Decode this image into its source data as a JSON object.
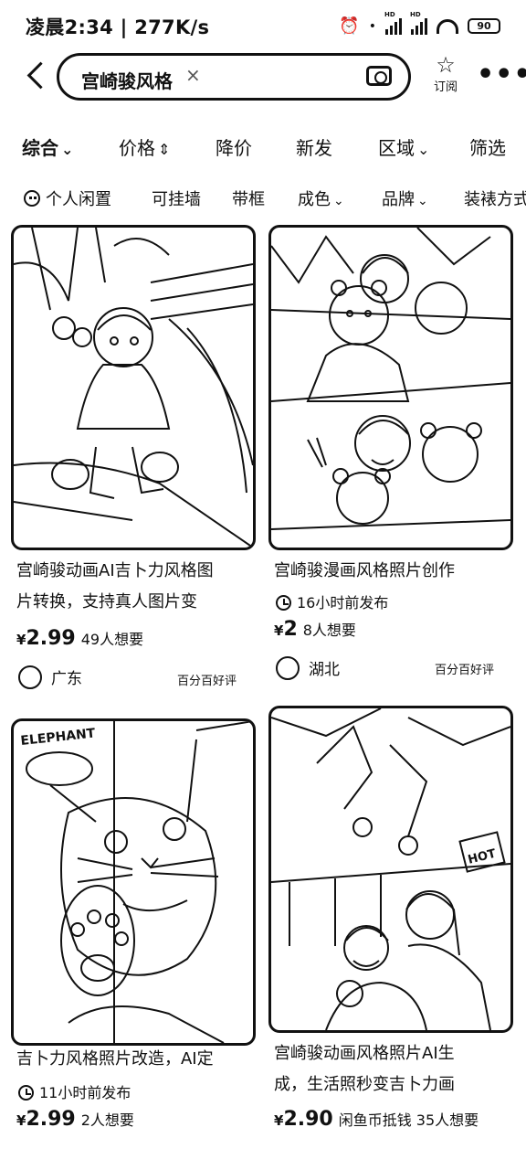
{
  "status_bar": {
    "time": "凌晨2:34 | 277K/s",
    "battery": "90"
  },
  "search": {
    "query": "宫崎骏风格",
    "clear": "×"
  },
  "header": {
    "subscribe_label": "订阅",
    "more": "•••"
  },
  "sort_tabs": [
    {
      "label": "综合",
      "arrow": "⌄"
    },
    {
      "label": "价格",
      "arrow": "⇕"
    },
    {
      "label": "降价",
      "arrow": ""
    },
    {
      "label": "新发",
      "arrow": ""
    },
    {
      "label": "区域",
      "arrow": "⌄"
    },
    {
      "label": "筛选",
      "arrow": ""
    }
  ],
  "chips": [
    {
      "label": "个人闲置",
      "arrow": ""
    },
    {
      "label": "可挂墙",
      "arrow": ""
    },
    {
      "label": "带框",
      "arrow": ""
    },
    {
      "label": "成色",
      "arrow": "⌄"
    },
    {
      "label": "品牌",
      "arrow": "⌄"
    },
    {
      "label": "装裱方式",
      "arrow": ""
    }
  ],
  "products": [
    {
      "title_line1": "宫崎骏动画AI吉卜力风格图",
      "title_line2": "片转换，支持真人图片变",
      "posted": "",
      "currency": "¥",
      "price": "2.99",
      "want": "49人想要",
      "region": "广东",
      "badge": "百分百好评"
    },
    {
      "title_line1": "宫崎骏漫画风格照片创作",
      "title_line2": "",
      "posted": "16小时前发布",
      "currency": "¥",
      "price": "2",
      "want": "8人想要",
      "region": "湖北",
      "badge": "百分百好评"
    },
    {
      "title_line1": "吉卜力风格照片改造，AI定",
      "title_line2": "",
      "posted": "11小时前发布",
      "currency": "¥",
      "price": "2.99",
      "want": "2人想要",
      "region": "",
      "badge": ""
    },
    {
      "title_line1": "宫崎骏动画风格照片AI生",
      "title_line2": "成，生活照秒变吉卜力画",
      "posted": "",
      "currency": "¥",
      "price": "2.90",
      "want": "闲鱼币抵钱 35人想要",
      "region": "",
      "badge": ""
    }
  ],
  "photo_text": {
    "elephant": "ELEPHANT",
    "hot": "HOT"
  }
}
